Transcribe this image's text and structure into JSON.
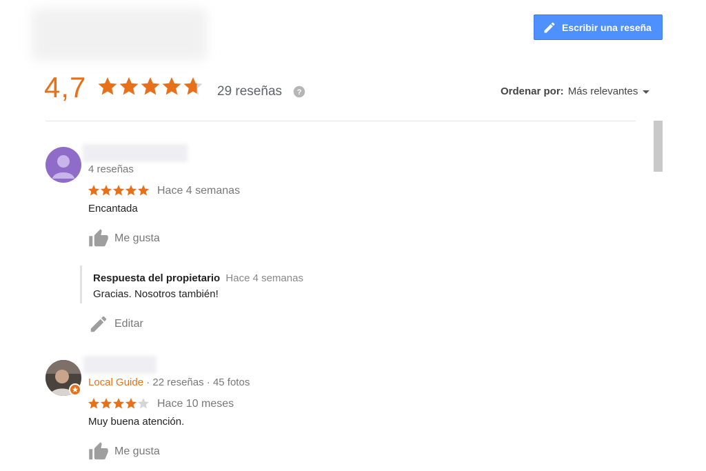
{
  "header": {
    "write_review_label": "Escribir una reseña",
    "rating_value": "4,7",
    "rating_stars": 4.7,
    "review_count": "29 reseñas",
    "sort_label": "Ordenar por:",
    "sort_value": "Más relevantes"
  },
  "colors": {
    "accent_orange": "#e7711b",
    "button_blue": "#4d90fe"
  },
  "reviews": [
    {
      "meta": "4 reseñas",
      "rating": 5,
      "time": "Hace 4 semanas",
      "text": "Encantada",
      "like_label": "Me gusta",
      "owner_reply": {
        "label": "Respuesta del propietario",
        "time": "Hace 4 semanas",
        "text": "Gracias. Nosotros también!"
      },
      "edit_label": "Editar"
    },
    {
      "guide_label": "Local Guide",
      "meta": "· 22 reseñas · 45 fotos",
      "rating": 4,
      "time": "Hace 10 meses",
      "text": "Muy buena atención.",
      "like_label": "Me gusta"
    }
  ]
}
